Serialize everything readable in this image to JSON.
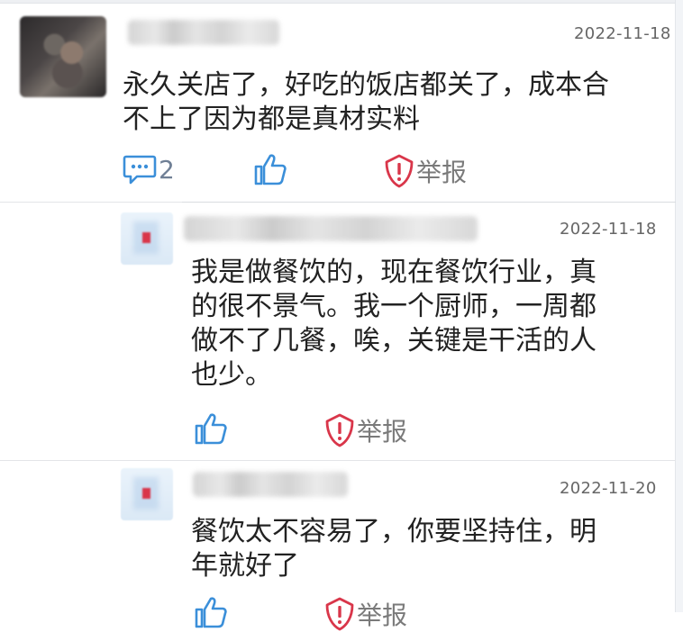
{
  "comments": [
    {
      "date": "2022-11-18",
      "text": "永久关店了，好吃的饭店都关了，成本合\n不上了因为都是真材实料",
      "comment_count": "2",
      "report_label": "举报"
    },
    {
      "date": "2022-11-18",
      "text": "我是做餐饮的，现在餐饮行业，真\n的很不景气。我一个厨师，一周都\n做不了几餐，唉，关键是干活的人\n也少。",
      "report_label": "举报"
    },
    {
      "date": "2022-11-20",
      "text": "餐饮太不容易了，你要坚持住，明\n年就好了",
      "report_label": "举报"
    }
  ],
  "colors": {
    "accent_blue": "#3b8fd9",
    "report_red": "#d9364a",
    "text": "#222222",
    "muted": "#666666"
  },
  "icons": {
    "comment": "comment-icon",
    "like": "thumbs-up-icon",
    "report": "shield-alert-icon"
  }
}
